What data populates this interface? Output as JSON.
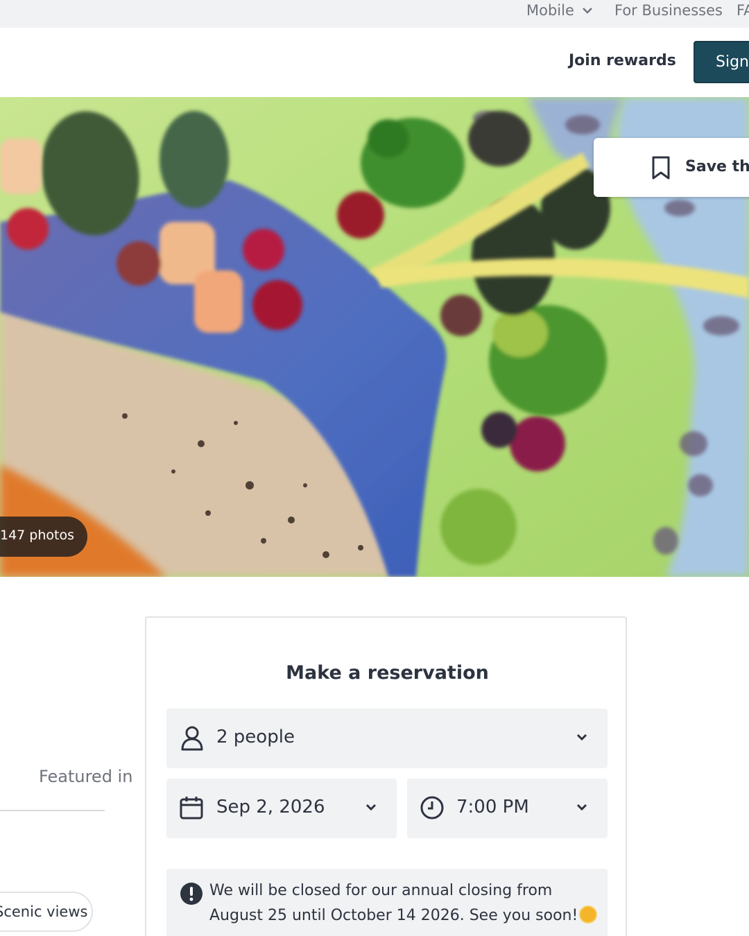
{
  "util_bar": {
    "mobile": "Mobile",
    "businesses": "For Businesses",
    "fa": "FA"
  },
  "header": {
    "join_rewards": "Join rewards",
    "sign_in": "Sign in"
  },
  "hero": {
    "save_label": "Save this restaurant",
    "photos_label": "147 photos"
  },
  "left": {
    "feature_label": "Featured in",
    "chip_label": "Scenic views"
  },
  "reservation": {
    "title": "Make a reservation",
    "party": "2 people",
    "date": "Sep 2, 2026",
    "time": "7:00 PM",
    "notice": "We will be closed for our annual closing from August 25 until October 14 2026. See you soon!"
  },
  "colors": {
    "brand_teal": "#1d4a5b",
    "field_bg": "#f1f2f4",
    "text": "#2d333f"
  },
  "icons": [
    "chevron-down-icon",
    "bookmark-icon",
    "person-icon",
    "calendar-icon",
    "clock-icon",
    "alert-icon",
    "sun-emoji-icon"
  ]
}
